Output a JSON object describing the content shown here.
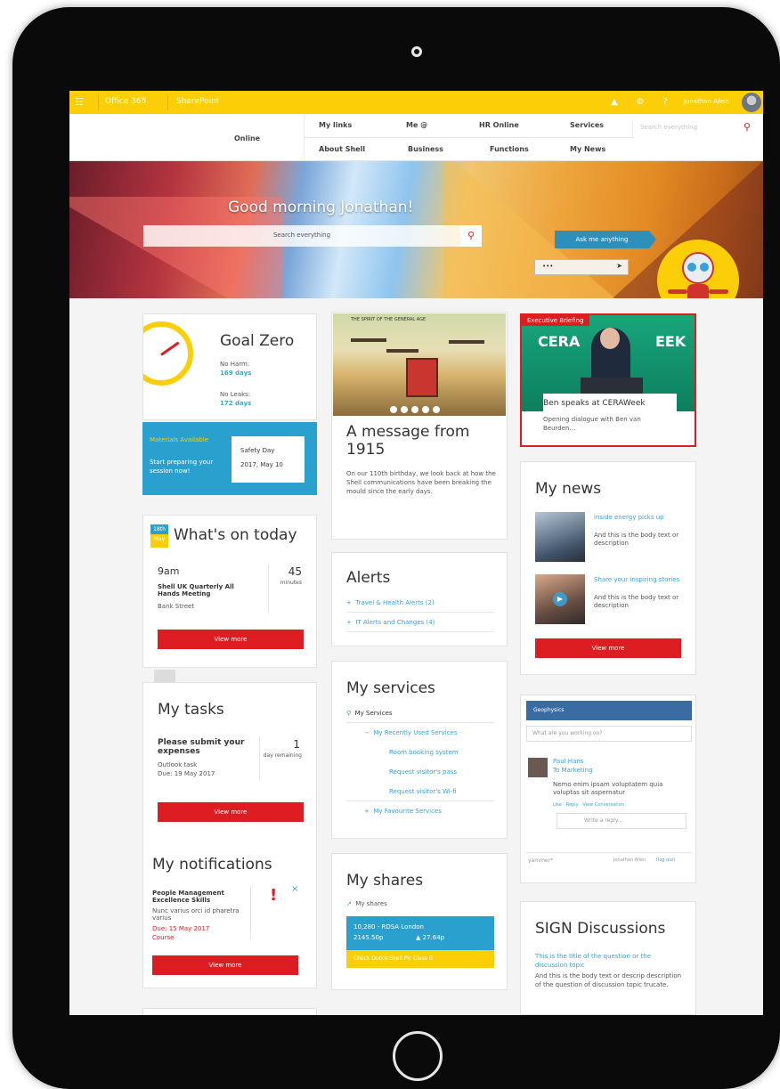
{
  "suitebar": {
    "office": "Office 365",
    "app": "SharePoint",
    "user": "Jonathan Allen"
  },
  "nav": {
    "site": "Online",
    "row1": [
      "My links",
      "Me @",
      "HR Online",
      "Services"
    ],
    "row2": [
      "About Shell",
      "Business",
      "Functions",
      "My News"
    ],
    "search_placeholder": "Search everything"
  },
  "hero": {
    "greeting": "Good morning Jonathan!",
    "search_placeholder": "Search everything",
    "ask": "Ask me anything",
    "ask_input": "•••"
  },
  "goal_zero": {
    "title": "Goal Zero",
    "harm_label": "No Harm:",
    "harm_value": "169 days",
    "leaks_label": "No Leaks:",
    "leaks_value": "172 days"
  },
  "safety": {
    "badge": "Materials Available",
    "cta": "Start preparing your session now!",
    "event": "Safety Day",
    "date": "2017, May 10"
  },
  "today": {
    "title": "What's on today",
    "day": "18th",
    "month": "May",
    "time": "9am",
    "event": "Shell UK Quarterly All Hands Meeting",
    "place": "Bank Street",
    "duration": "45",
    "unit": "minutes",
    "button": "View more"
  },
  "tasks": {
    "title": "My tasks",
    "task": "Please submit your expenses",
    "source": "Outlook task",
    "due": "Due: 19 May 2017",
    "count": "1",
    "unit": "day remaining",
    "button": "View more"
  },
  "notifications": {
    "title": "My notifications",
    "item": "People Management Excellence Skills",
    "body": "Nunc varius orci id pharetra varius",
    "due": "Due: 15 May 2017",
    "type": "Course",
    "mark": "!",
    "close": "×",
    "button": "View more"
  },
  "message": {
    "title": "A message from 1915",
    "body": "On our 110th birthday, we look back at how the Shell communications have been breaking the mould since the early days.",
    "caption": "THE SPIRIT OF THE GENERAL AGE"
  },
  "alerts": {
    "title": "Alerts",
    "items": [
      "Travel & Health Alerts (2)",
      "IT Alerts and Changes (4)"
    ]
  },
  "services": {
    "title": "My services",
    "root": "My Services",
    "recent": "My Recently Used Services",
    "items": [
      "Room booking system",
      "Request visitor's pass",
      "Request visitor's Wi-fi"
    ],
    "favourites": "My Favourite Services"
  },
  "shares": {
    "title": "My shares",
    "link": "My shares",
    "line1": "10,280 - RDSA London",
    "line2": "2145.50p",
    "change": "27.64p",
    "cta": "Check Dutch Shell Plc Class B"
  },
  "briefing": {
    "tag": "Executive Briefing",
    "title": "Ben speaks at CERAWeek",
    "body": "Opening dialogue with Ben van Beurden...",
    "brand": "CERA",
    "brand2": "EEK"
  },
  "news": {
    "title": "My news",
    "items": [
      {
        "head": "inside energy picks up",
        "body": "And this is the body text or description"
      },
      {
        "head": "Share your inspiring stories",
        "body": "And this is the body text or description"
      }
    ],
    "button": "View more"
  },
  "yammer": {
    "group": "Geophysics",
    "placeholder": "What are you working on?",
    "author": "Paul Hans",
    "to": "To Marketing",
    "post": "Nemo enim ipsam voluptatem quia voluptas sit aspernatur",
    "actions": "Like · Reply · View Conversation",
    "reply": "Write a reply...",
    "brand": "yammer*",
    "user": "Jonathan Allen",
    "logout": "(log out)"
  },
  "sign": {
    "title": "SIGN Discussions",
    "question": "This is the title of the question or the discussion topic",
    "body": "And this is the body text or descrip description of the question of discussion topic trucate."
  },
  "colors": {
    "shell_yellow": "#fbce07",
    "shell_red": "#dd1d21",
    "blue": "#2aa0cf"
  }
}
